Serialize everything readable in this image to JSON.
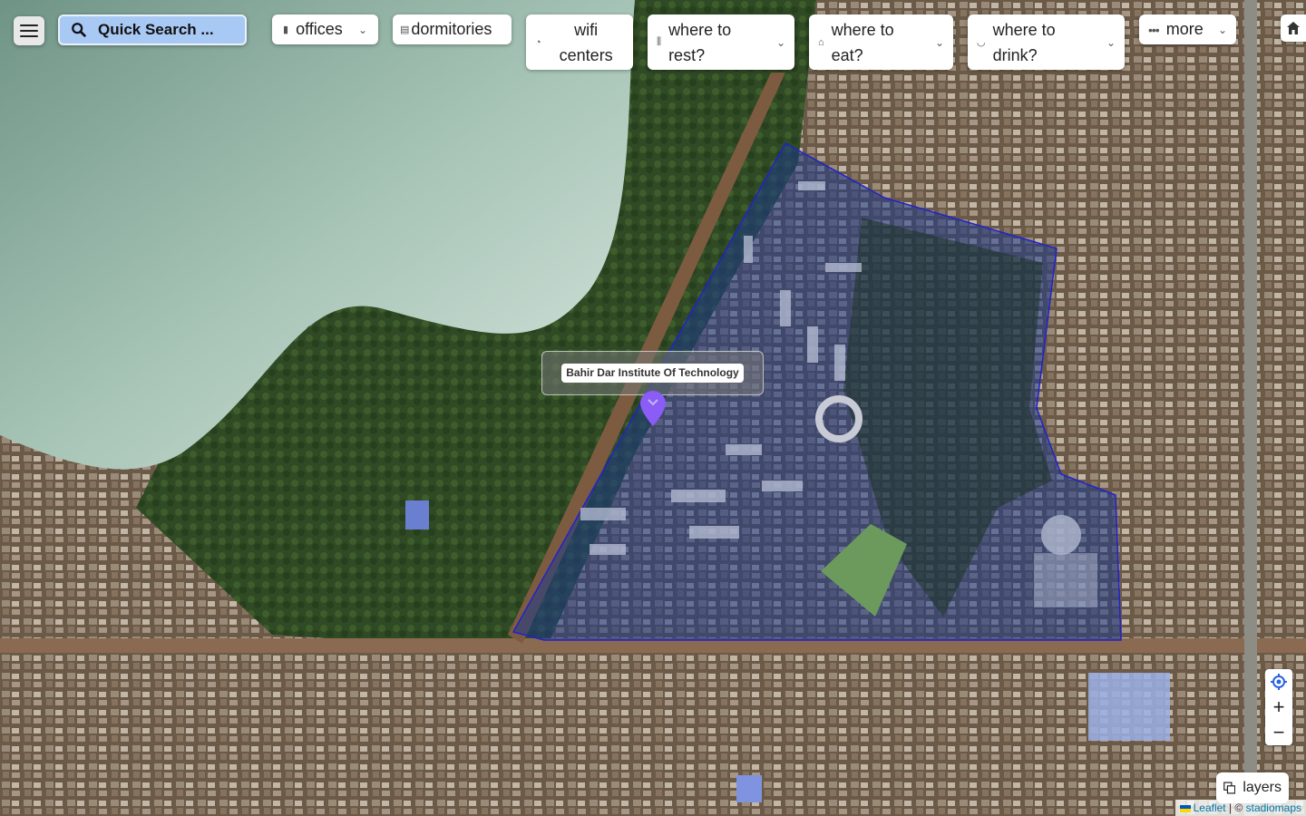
{
  "toolbar": {
    "search_label": "Quick Search ...",
    "buttons": [
      {
        "label": "offices",
        "icon": "building-icon"
      },
      {
        "label": "dormitories",
        "icon": "dorm-icon"
      },
      {
        "label": "wifi centers",
        "line1": "wifi",
        "line2": "centers",
        "icon": "wifi-icon"
      },
      {
        "label": "where to rest?",
        "line1": "where to",
        "line2": "rest?",
        "icon": "rest-icon"
      },
      {
        "label": "where to eat?",
        "line1": "where to",
        "line2": "eat?",
        "icon": "eat-icon"
      },
      {
        "label": "where to drink?",
        "line1": "where to",
        "line2": "drink?",
        "icon": "drink-icon"
      },
      {
        "label": "more",
        "icon": "more-icon"
      }
    ]
  },
  "map": {
    "popup_label": "Bahir Dar Institute Of Technology",
    "polygon_color": "#1e3a8a",
    "marker_color": "#8b5cf6"
  },
  "controls": {
    "zoom_in": "+",
    "zoom_out": "−",
    "layers_label": "layers"
  },
  "attribution": {
    "leaflet": "Leaflet",
    "separator": "| ©",
    "provider": "stadiomaps"
  }
}
